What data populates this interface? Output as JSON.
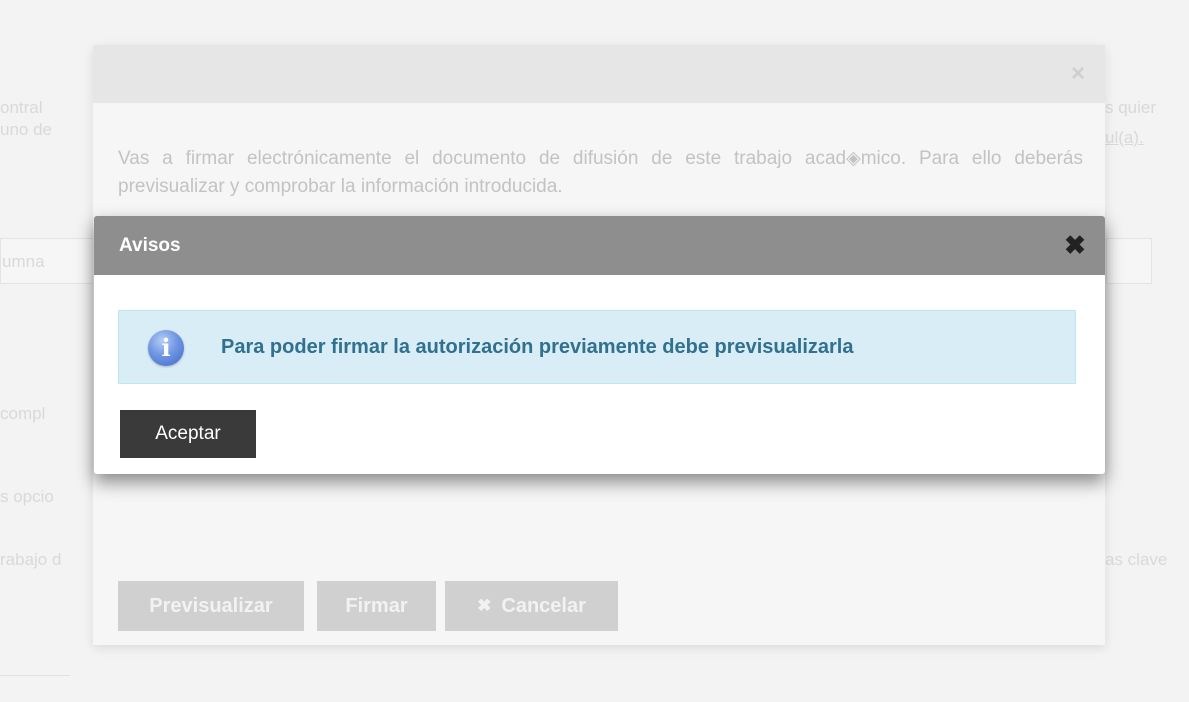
{
  "background": {
    "fragments": [
      {
        "name": "bg-text-1",
        "text": "ontral"
      },
      {
        "name": "bg-text-2",
        "text": "uno de"
      },
      {
        "name": "bg-text-3",
        "text": "s quier"
      },
      {
        "name": "bg-text-4",
        "text": "ul(a)."
      },
      {
        "name": "bg-text-5",
        "text": "umna"
      },
      {
        "name": "bg-text-6",
        "text": "compl"
      },
      {
        "name": "bg-text-7",
        "text": "s opcio"
      },
      {
        "name": "bg-text-8",
        "text": "rabajo d"
      },
      {
        "name": "bg-text-9",
        "text": "as clave"
      }
    ]
  },
  "outer_dialog": {
    "close_icon": "×",
    "text": "Vas a firmar electrónicamente el documento de difusión de este trabajo acad◈mico. Para ello deberás previsualizar y comprobar la información introducida.",
    "buttons": {
      "preview": "Previsualizar",
      "sign": "Firmar",
      "cancel_icon": "✖",
      "cancel": "Cancelar"
    }
  },
  "modal": {
    "title": "Avisos",
    "close_icon": "✖",
    "info_icon": "i",
    "message": "Para poder firmar la autorización previamente debe previsualizarla",
    "accept_label": "Aceptar"
  },
  "colors": {
    "modal_header": "#8e8e8e",
    "alert_bg": "#d9edf7",
    "alert_text": "#31708f",
    "accept_button": "#3a3a3a"
  }
}
